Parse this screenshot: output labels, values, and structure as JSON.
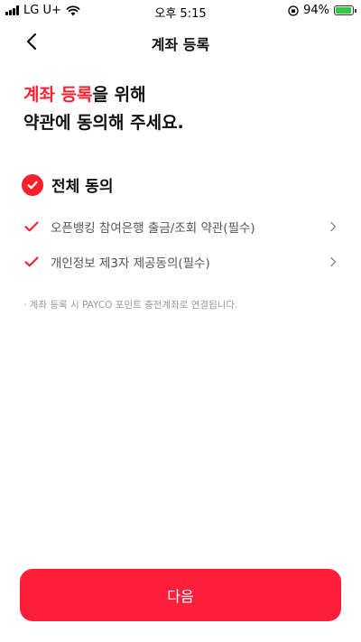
{
  "status_bar": {
    "carrier": "LG U+",
    "time": "오후 5:15",
    "battery": "94%",
    "battery_level": 0.94
  },
  "navbar": {
    "title": "계좌 등록",
    "back_icon": "chevron-left-icon"
  },
  "headline": {
    "accent": "계좌 등록",
    "line1_rest": "을 위해",
    "line2": "약관에 동의해 주세요."
  },
  "agree_all": {
    "label": "전체 동의",
    "checked": true
  },
  "terms": [
    {
      "label": "오픈뱅킹 참여은행 출금/조회 약관(필수)",
      "checked": true
    },
    {
      "label": "개인정보 제3자 제공동의(필수)",
      "checked": true
    }
  ],
  "notice": "· 계좌 등록 시 PAYCO 포인트 충전계좌로 연결됩니다.",
  "next_button": {
    "label": "다음"
  },
  "colors": {
    "accent": "#ff1e2e",
    "button": "#ff1f3a"
  }
}
